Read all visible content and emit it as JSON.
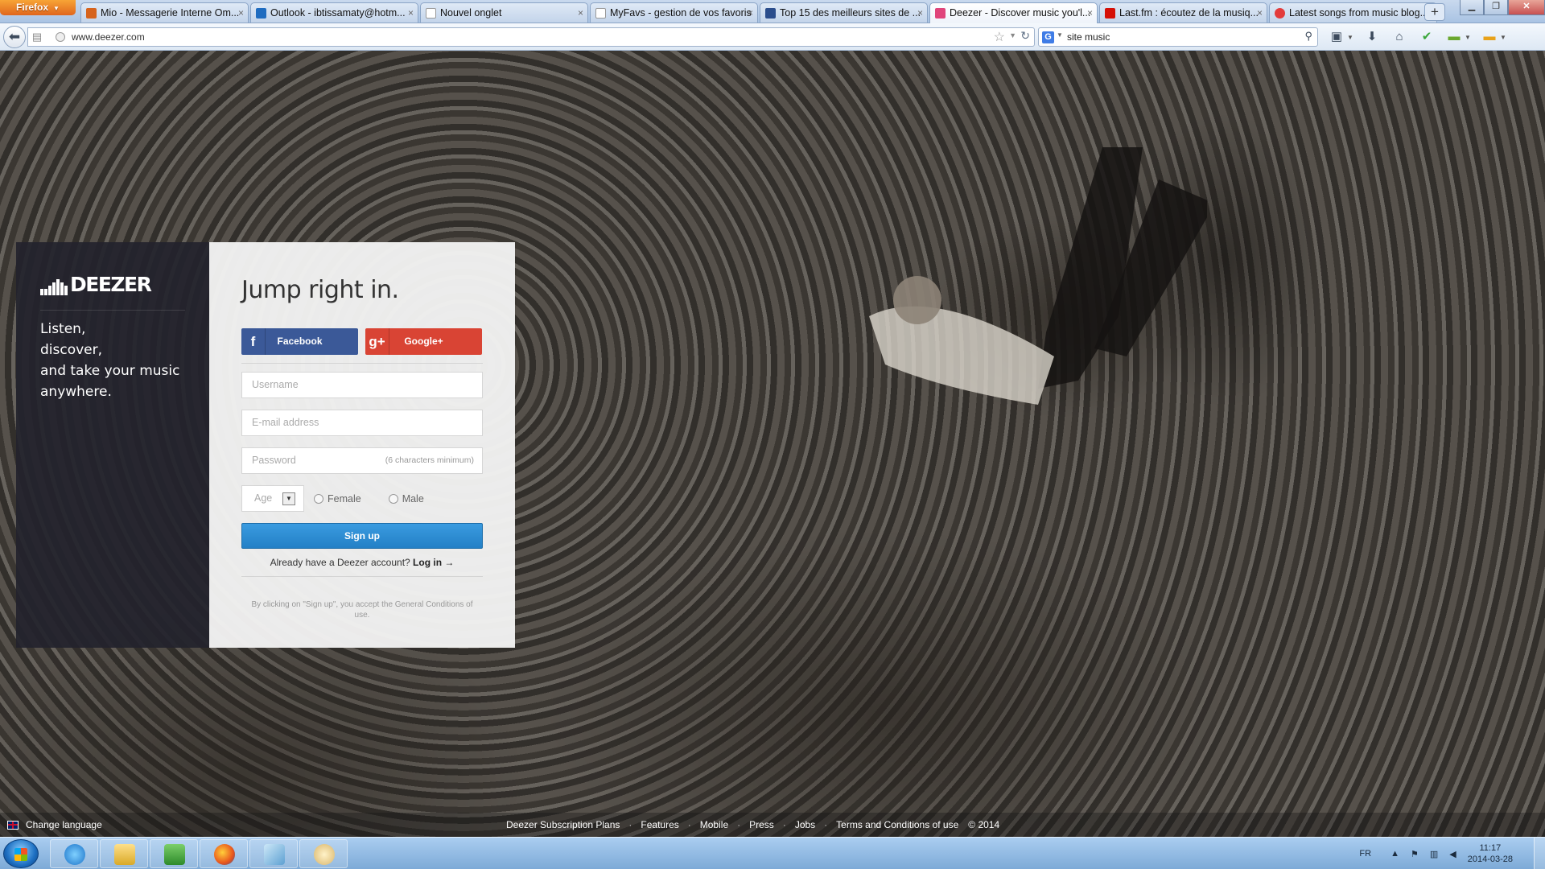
{
  "browser": {
    "menu_button": "Firefox",
    "tabs": [
      {
        "title": "Mio - Messagerie Interne Om...",
        "favicon_color": "#d6631d"
      },
      {
        "title": "Outlook - ibtissamaty@hotm...",
        "favicon_color": "#1f6cc0"
      },
      {
        "title": "Nouvel onglet",
        "favicon_color": "#ffffff"
      },
      {
        "title": "MyFavs - gestion de vos favoris",
        "favicon_color": "#ffffff"
      },
      {
        "title": "Top 15 des meilleurs sites de ...",
        "favicon_color": "#2a4d8c"
      },
      {
        "title": "Deezer - Discover music you'l...",
        "favicon_color": "#e0457b",
        "active": true
      },
      {
        "title": "Last.fm : écoutez de la musiq...",
        "favicon_color": "#d51007"
      },
      {
        "title": "Latest songs from music blog...",
        "favicon_color": "#e33b3b"
      }
    ],
    "new_tab": "+",
    "url": "www.deezer.com",
    "search_query": "site music",
    "search_engine_icon": "G"
  },
  "page": {
    "logo_text": "DEEZER",
    "tagline": [
      "Listen,",
      "discover,",
      "and take your music",
      "anywhere."
    ],
    "title": "Jump right in.",
    "social": {
      "facebook_label": "Facebook",
      "facebook_icon": "f",
      "google_label": "Google+",
      "google_icon": "g+"
    },
    "form": {
      "username_placeholder": "Username",
      "email_placeholder": "E-mail address",
      "password_placeholder": "Password",
      "password_hint": "(6 characters minimum)",
      "age_placeholder": "Age",
      "female_label": "Female",
      "male_label": "Male",
      "signup_label": "Sign up",
      "login_prompt": "Already have a Deezer account?",
      "login_link": "Log in",
      "terms": "By clicking on \"Sign up\", you accept the General Conditions of use."
    },
    "footer": {
      "change_language": "Change language",
      "links": [
        "Deezer Subscription Plans",
        "Features",
        "Mobile",
        "Press",
        "Jobs",
        "Terms and Conditions of use"
      ],
      "copyright": "© 2014"
    }
  },
  "taskbar": {
    "language": "FR",
    "time": "11:17",
    "date": "2014-03-28"
  },
  "colors": {
    "facebook": "#3b5998",
    "google": "#d94434",
    "signup": "#2a8ad4",
    "brand_panel": "#23232d"
  }
}
